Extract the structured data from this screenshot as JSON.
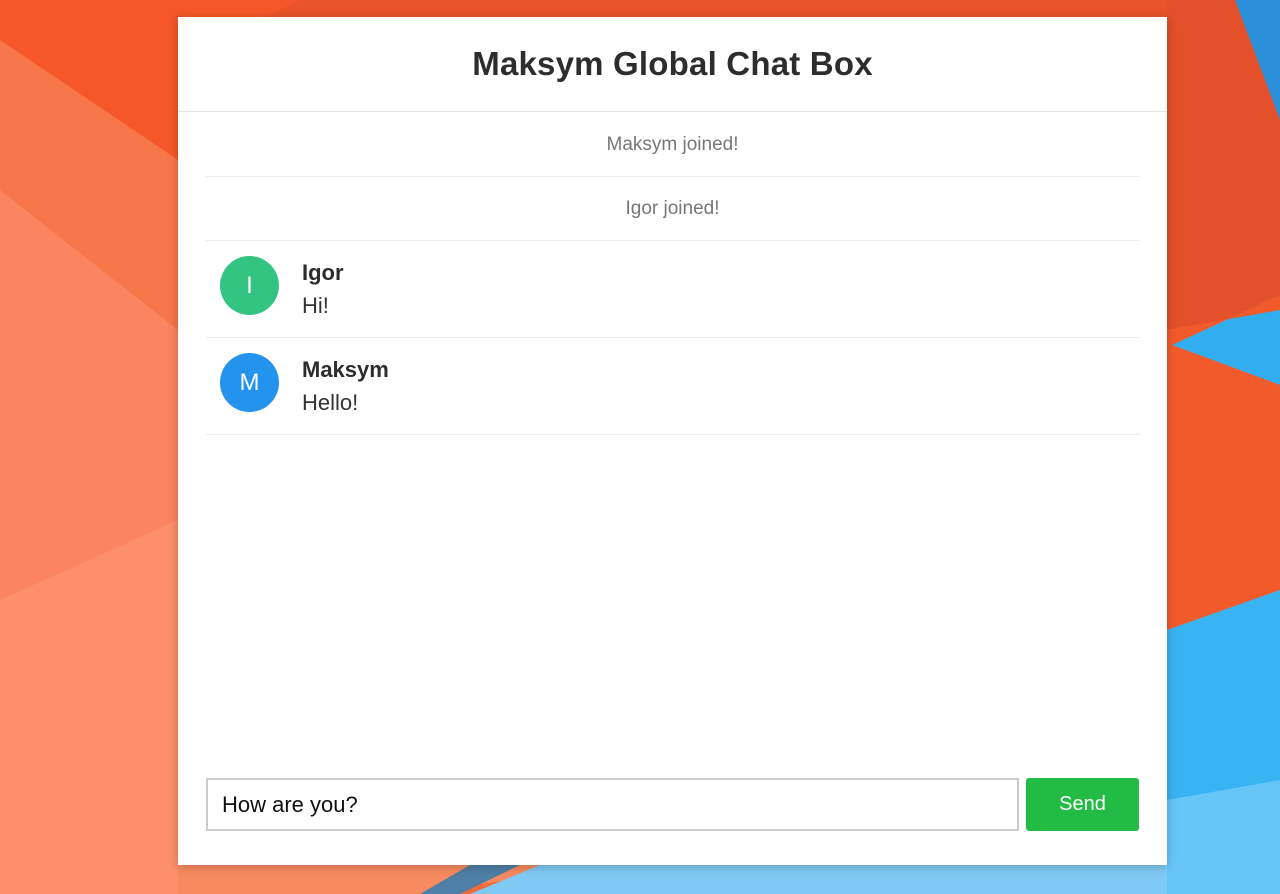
{
  "chat": {
    "title": "Maksym Global Chat Box",
    "system_messages": [
      "Maksym joined!",
      "Igor joined!"
    ],
    "messages": [
      {
        "initial": "I",
        "author": "Igor",
        "text": "Hi!",
        "avatar_color": "#33c482"
      },
      {
        "initial": "M",
        "author": "Maksym",
        "text": "Hello!",
        "avatar_color": "#2493ee"
      }
    ],
    "composer": {
      "input_value": "How are you?",
      "send_label": "Send"
    }
  },
  "colors": {
    "send_button": "#22bc45",
    "wallpaper_orange": "#f0703f",
    "wallpaper_blue": "#3ab3f2"
  }
}
